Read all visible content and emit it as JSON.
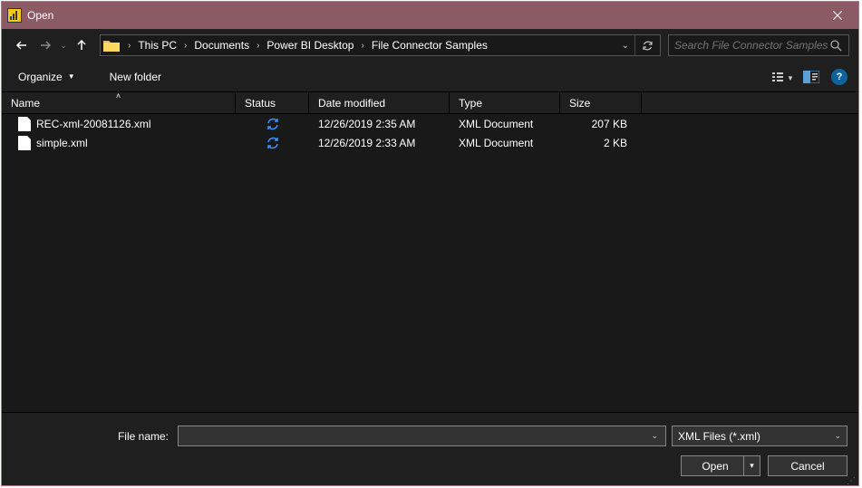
{
  "window": {
    "title": "Open"
  },
  "nav": {
    "breadcrumbs": [
      "This PC",
      "Documents",
      "Power BI Desktop",
      "File Connector Samples"
    ],
    "search_placeholder": "Search File Connector Samples"
  },
  "toolbar": {
    "organize_label": "Organize",
    "newfolder_label": "New folder",
    "help_label": "?"
  },
  "columns": {
    "name": "Name",
    "status": "Status",
    "date": "Date modified",
    "type": "Type",
    "size": "Size"
  },
  "files": [
    {
      "name": "REC-xml-20081126.xml",
      "date": "12/26/2019 2:35 AM",
      "type": "XML Document",
      "size": "207 KB"
    },
    {
      "name": "simple.xml",
      "date": "12/26/2019 2:33 AM",
      "type": "XML Document",
      "size": "2 KB"
    }
  ],
  "bottom": {
    "filename_label": "File name:",
    "filename_value": "",
    "filter_label": "XML Files (*.xml)",
    "open_label": "Open",
    "cancel_label": "Cancel"
  }
}
